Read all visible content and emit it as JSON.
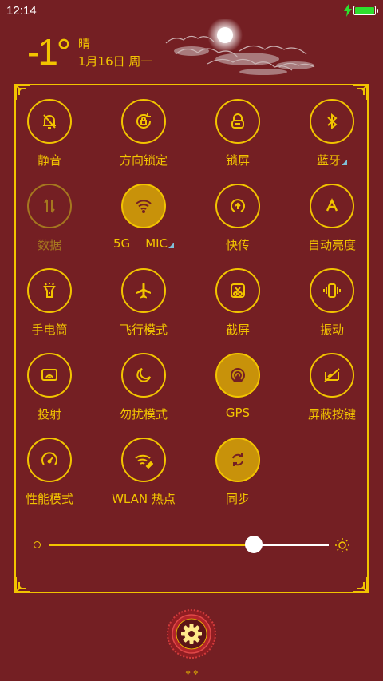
{
  "status_bar": {
    "time": "12:14"
  },
  "weather": {
    "temperature": "-1°",
    "condition": "晴",
    "date": "1月16日 周一"
  },
  "tiles": [
    {
      "label": "静音",
      "icon": "bell-off-icon",
      "state": "off"
    },
    {
      "label": "方向锁定",
      "icon": "rotation-lock-icon",
      "state": "off"
    },
    {
      "label": "锁屏",
      "icon": "lock-icon",
      "state": "off"
    },
    {
      "label": "蓝牙",
      "icon": "bluetooth-icon",
      "state": "off",
      "has_more": true
    },
    {
      "label": "数据",
      "icon": "mobile-data-icon",
      "state": "disabled"
    },
    {
      "label": "5G    MIC",
      "icon": "wifi-icon",
      "state": "on",
      "has_more": true
    },
    {
      "label": "快传",
      "icon": "quick-transfer-icon",
      "state": "off"
    },
    {
      "label": "自动亮度",
      "icon": "auto-brightness-icon",
      "state": "off"
    },
    {
      "label": "手电筒",
      "icon": "flashlight-icon",
      "state": "off"
    },
    {
      "label": "飞行模式",
      "icon": "airplane-icon",
      "state": "off"
    },
    {
      "label": "截屏",
      "icon": "screenshot-icon",
      "state": "off"
    },
    {
      "label": "振动",
      "icon": "vibrate-icon",
      "state": "off"
    },
    {
      "label": "投射",
      "icon": "cast-icon",
      "state": "off"
    },
    {
      "label": "勿扰模式",
      "icon": "moon-icon",
      "state": "off"
    },
    {
      "label": "GPS",
      "icon": "gps-icon",
      "state": "on"
    },
    {
      "label": "屏蔽按键",
      "icon": "block-keys-icon",
      "state": "off"
    },
    {
      "label": "性能模式",
      "icon": "speedometer-icon",
      "state": "off"
    },
    {
      "label": "WLAN 热点",
      "icon": "hotspot-icon",
      "state": "off"
    },
    {
      "label": "同步",
      "icon": "sync-icon",
      "state": "on"
    }
  ],
  "brightness": {
    "value": 0.73
  },
  "colors": {
    "background": "#741f23",
    "accent": "#f2c400",
    "active_fill": "#c8920a"
  }
}
